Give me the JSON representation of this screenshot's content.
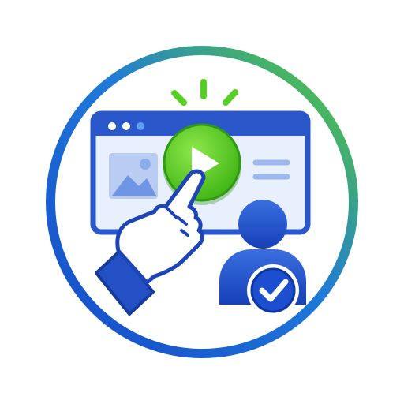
{
  "icon": {
    "subject": "user-clicks-video-play-icon",
    "elements": [
      "outer-ring",
      "sparkle-lines",
      "browser-window",
      "image-placeholder-icon",
      "text-lines",
      "play-button",
      "pointing-hand-cursor",
      "user-avatar-icon",
      "checkmark-badge"
    ]
  },
  "colors": {
    "ring_blue": "#1f5fd6",
    "ring_green": "#57d12c",
    "browser_blue": "#2a57c9",
    "browser_fill": "#e9f0fd",
    "play_green": "#4fc51d",
    "play_green_light": "#7be23b",
    "hand_white": "#ffffff",
    "cuff_blue": "#2350c5",
    "user_blue": "#1d4fcc",
    "check_badge": "#1b4fd0"
  }
}
